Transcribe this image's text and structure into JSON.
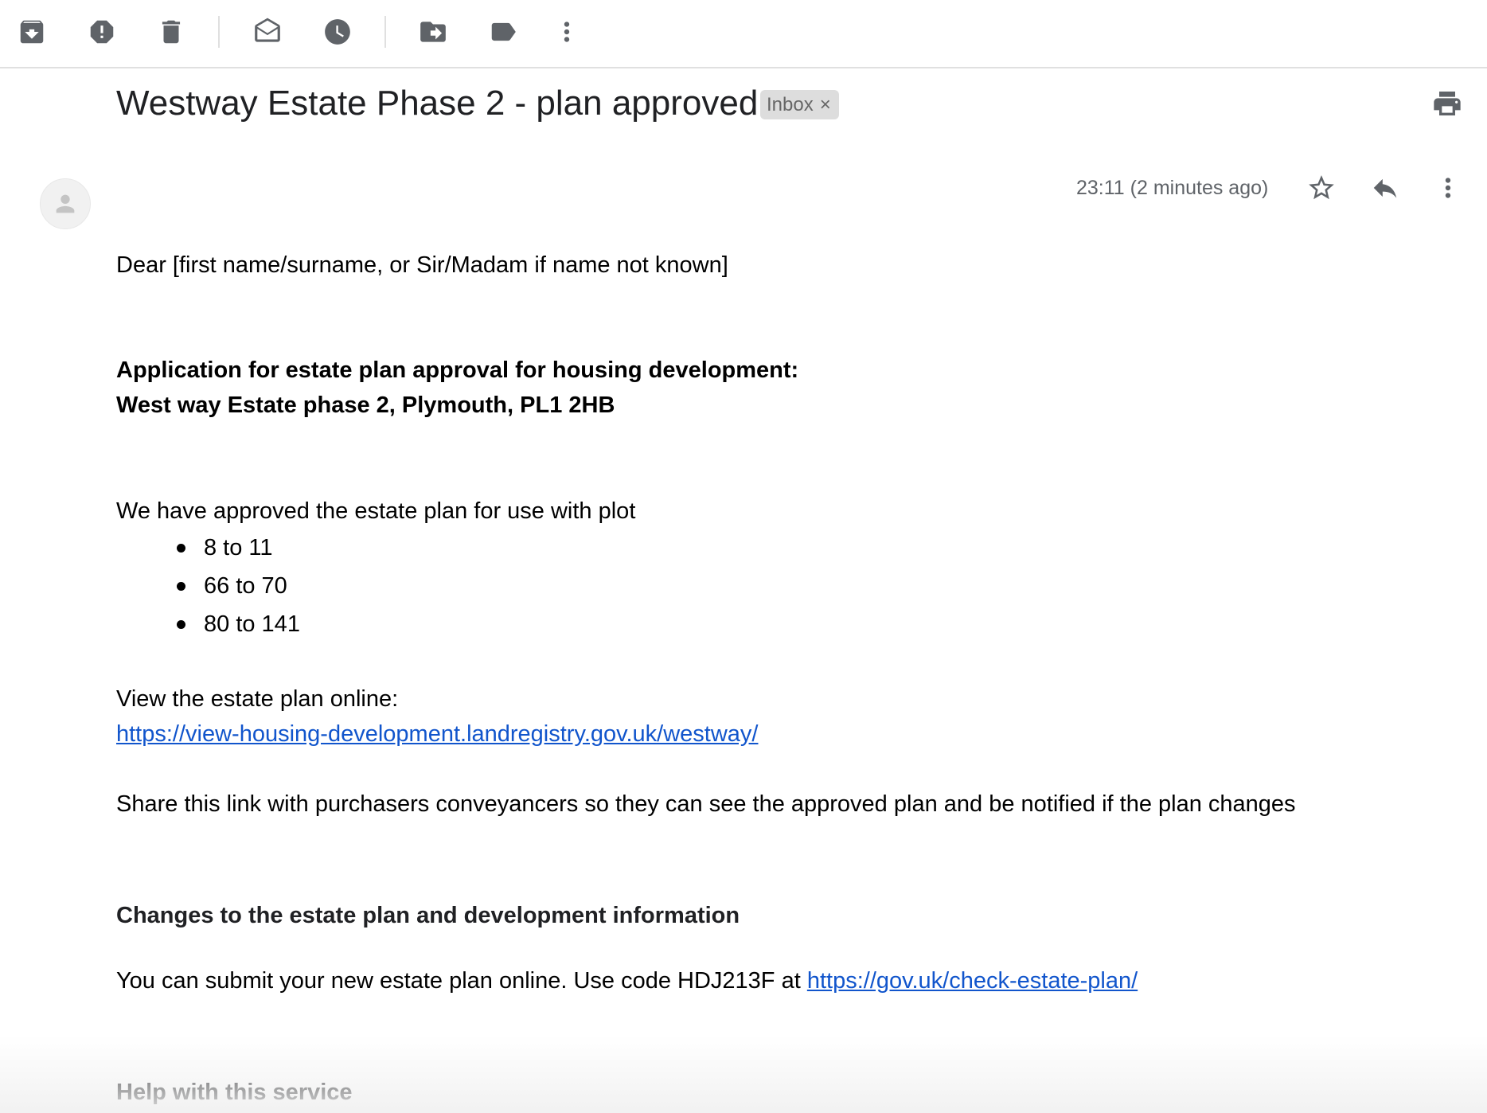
{
  "toolbar": {
    "icons": [
      "archive-icon",
      "report-spam-icon",
      "delete-icon",
      "mark-as-read-icon",
      "snooze-icon",
      "move-to-icon",
      "label-icon",
      "more-vert-icon"
    ]
  },
  "email": {
    "subject": "Westway Estate Phase 2 - plan approved",
    "label": "Inbox",
    "label_close": "×",
    "timestamp": "23:11 (2 minutes ago)",
    "greeting": "Dear [first name/surname, or Sir/Madam if name not known]",
    "application_title_line1": "Application for estate plan approval for housing development:",
    "application_title_line2": "West way Estate phase 2, Plymouth, PL1 2HB",
    "approval_intro": "We have approved the estate plan for use with plot",
    "plots": [
      "8 to 11",
      "66 to 70",
      "80 to 141"
    ],
    "view_online_label": "View the estate plan online:",
    "view_online_link": "https://view-housing-development.landregistry.gov.uk/westway/",
    "share_text": "Share this link with purchasers conveyancers so they can see the approved plan and be notified if the plan changes",
    "changes_heading": "Changes to the estate plan and development information",
    "submit_text": "You can submit your new estate plan online. Use code HDJ213F at ",
    "submit_link": "https://gov.uk/check-estate-plan/",
    "help_heading": "Help with this service"
  },
  "colors": {
    "icon_gray": "#5f6368",
    "link_blue": "#1155cc",
    "chip_bg": "#dddddd"
  }
}
